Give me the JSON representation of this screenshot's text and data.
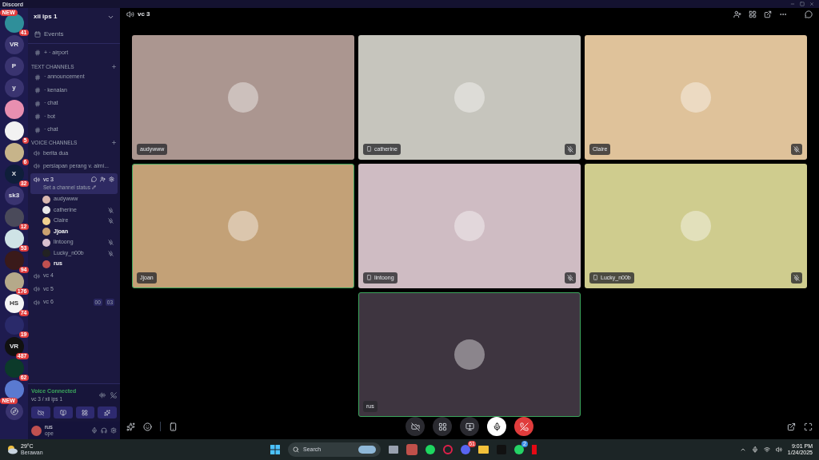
{
  "window": {
    "title": "Discord"
  },
  "servers": [
    {
      "badge": "41",
      "kind": "avatar",
      "color": "#2f8f9a",
      "tag": "NEW"
    },
    {
      "label": "VR",
      "kind": "text",
      "color": "#3a3470"
    },
    {
      "label": "P",
      "kind": "text",
      "color": "#3a3470"
    },
    {
      "label": "y",
      "kind": "text",
      "color": "#3a3470"
    },
    {
      "kind": "avatar",
      "color": "#e88fb0"
    },
    {
      "badge": "5",
      "kind": "avatar",
      "color": "#f2f2f2"
    },
    {
      "badge": "6",
      "kind": "avatar",
      "color": "#c7b48a"
    },
    {
      "label": "X",
      "badge": "32",
      "kind": "text",
      "color": "#0f1e3a"
    },
    {
      "label": "sk3",
      "kind": "text",
      "color": "#3a3470"
    },
    {
      "badge": "12",
      "kind": "avatar",
      "color": "#4a4a5a"
    },
    {
      "badge": "53",
      "kind": "avatar",
      "color": "#cfe3e6"
    },
    {
      "badge": "94",
      "kind": "avatar",
      "color": "#3a1a1a"
    },
    {
      "badge": "176",
      "kind": "avatar",
      "color": "#b5a98a"
    },
    {
      "label": "HS",
      "badge": "74",
      "kind": "text",
      "color": "#f4f4f4"
    },
    {
      "badge": "19",
      "kind": "avatar",
      "color": "#2a2a6a"
    },
    {
      "label": "VR",
      "badge": "487",
      "kind": "text",
      "color": "#111111"
    },
    {
      "badge": "62",
      "kind": "avatar",
      "color": "#0c3a2a"
    },
    {
      "kind": "avatar",
      "color": "#5a7ad0",
      "tag": "NEW"
    }
  ],
  "server_name": "xii ips 1",
  "events": "Events",
  "top_channel": "+ · airport",
  "text_category": "TEXT CHANNELS",
  "text_channels": [
    "· announcement",
    "· kenalan",
    "· chat",
    "· bot",
    "· chat"
  ],
  "voice_category": "VOICE CHANNELS",
  "voice_channels": [
    {
      "name": "berita dua",
      "selected": false
    },
    {
      "name": "persiapan perang v. almi...",
      "selected": false
    },
    {
      "name": "vc 3",
      "selected": true,
      "status": "Set a channel status",
      "users": [
        {
          "name": "audywww",
          "muted": false,
          "speaking": false,
          "color": "#d9b8b0"
        },
        {
          "name": "catherine",
          "muted": true,
          "speaking": false,
          "color": "#e8e8e8"
        },
        {
          "name": "Claire",
          "muted": true,
          "speaking": false,
          "color": "#f0d090"
        },
        {
          "name": "Jjoan",
          "muted": false,
          "speaking": true,
          "color": "#c9a070"
        },
        {
          "name": "lintoong",
          "muted": true,
          "speaking": false,
          "color": "#d8c0d0"
        },
        {
          "name": "Lucky_n00b",
          "muted": true,
          "speaking": false,
          "color": "#222222"
        },
        {
          "name": "rus",
          "muted": false,
          "speaking": true,
          "color": "#c05050"
        }
      ]
    },
    {
      "name": "vc 4",
      "selected": false
    },
    {
      "name": "vc 5",
      "selected": false
    },
    {
      "name": "vc 6",
      "selected": false,
      "limit": [
        "00",
        "03"
      ]
    }
  ],
  "voice_panel": {
    "title": "Voice Connected",
    "subtitle": "vc 3 / xii ips 1"
  },
  "user_panel": {
    "name": "rus",
    "status": "ope"
  },
  "header": {
    "channel": "vc 3"
  },
  "tiles": [
    {
      "name": "audywww",
      "mobile": false,
      "muted": false,
      "speaking": false,
      "color": "#ab9690"
    },
    {
      "name": "catherine",
      "mobile": true,
      "muted": true,
      "speaking": false,
      "color": "#c6c5bd"
    },
    {
      "name": "Claire",
      "mobile": false,
      "muted": true,
      "speaking": false,
      "color": "#dfc29a"
    },
    {
      "name": "Jjoan",
      "mobile": false,
      "muted": false,
      "speaking": true,
      "color": "#c3a177"
    },
    {
      "name": "lintoong",
      "mobile": true,
      "muted": true,
      "speaking": false,
      "color": "#cfbcc3"
    },
    {
      "name": "Lucky_n00b",
      "mobile": true,
      "muted": true,
      "speaking": false,
      "color": "#cfcc8e"
    },
    {
      "name": "rus",
      "mobile": false,
      "muted": false,
      "speaking": true,
      "color": "#3e3540"
    }
  ],
  "taskbar": {
    "weather_temp": "29°C",
    "weather_text": "Berawan",
    "search": "Search",
    "discord_badge": "61",
    "whatsapp_badge": "2",
    "time": "9:01 PM",
    "date": "1/24/2025"
  }
}
